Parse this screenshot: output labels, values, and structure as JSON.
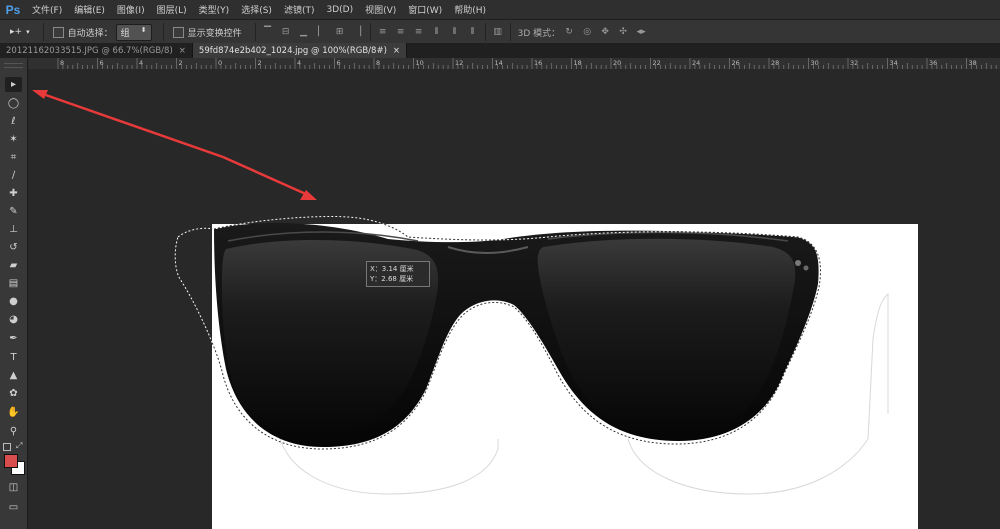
{
  "app": {
    "logo": "Ps"
  },
  "menu": [
    "文件(F)",
    "编辑(E)",
    "图像(I)",
    "图层(L)",
    "类型(Y)",
    "选择(S)",
    "滤镜(T)",
    "3D(D)",
    "视图(V)",
    "窗口(W)",
    "帮助(H)"
  ],
  "options": {
    "move_symbol": "▸+",
    "auto_select_label": "自动选择：",
    "auto_select_value": "组",
    "show_transform_label": "显示变换控件",
    "mode_3d_label": "3D 模式："
  },
  "tabs": [
    {
      "label": "20121162033515.JPG @ 66.7%(RGB/8)"
    },
    {
      "label": "59fd874e2b402_1024.jpg @ 100%(RGB/8#)",
      "active": true
    }
  ],
  "ruler": {
    "labels": [
      "8",
      "6",
      "4",
      "2",
      "0",
      "2",
      "4",
      "6",
      "8",
      "10",
      "12",
      "14",
      "16",
      "18",
      "20",
      "22",
      "24",
      "26",
      "28",
      "30",
      "32",
      "34",
      "36",
      "38"
    ]
  },
  "tooltip": {
    "line1": "X：3.14 厘米",
    "line2": "Y：2.68 厘米"
  },
  "colors": {
    "accent_arrow": "#e83a3a",
    "foreground": "#d84d4d",
    "background": "#ffffff"
  }
}
